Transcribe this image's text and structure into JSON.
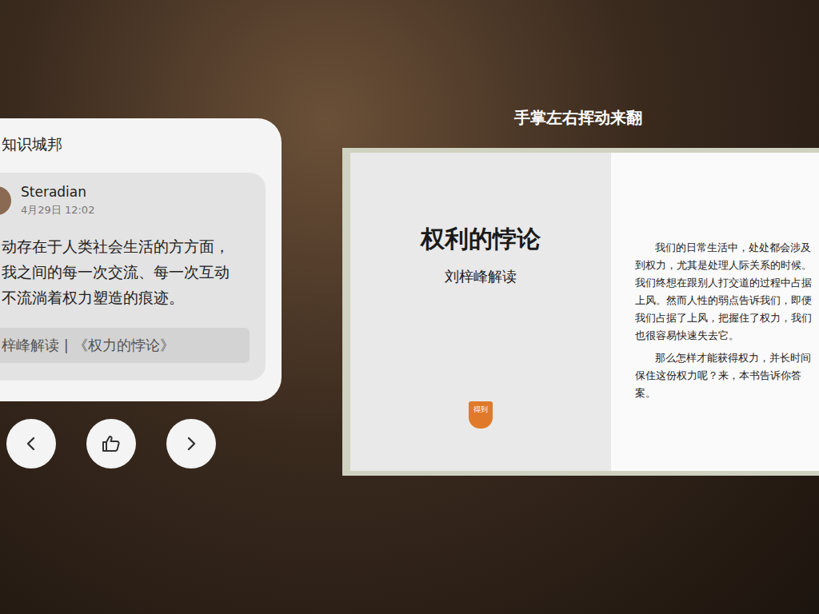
{
  "hint": "手掌左右挥动来翻",
  "panel": {
    "title": "知识城邦",
    "post": {
      "author": "Steradian",
      "time": "4月29日 12:02",
      "lines": [
        "动存在于人类社会生活的方方面，",
        "我之间的每一次交流、每一次互动",
        "不流淌着权力塑造的痕迹。"
      ],
      "source": "梓峰解读 | 《权力的悖论》"
    }
  },
  "book": {
    "title": "权利的悖论",
    "subtitle": "刘梓峰解读",
    "logo": "得到",
    "paragraphs": [
      "我们的日常生活中，处处都会涉及到权力，尤其是处理人际关系的时候。我们终想在跟别人打交道的过程中占据上风。然而人性的弱点告诉我们，即便我们占据了上风，把握住了权力，我们也很容易快速失去它。",
      "那么怎样才能获得权力，并长时间保住这份权力呢？来，本书告诉你答案。"
    ]
  }
}
